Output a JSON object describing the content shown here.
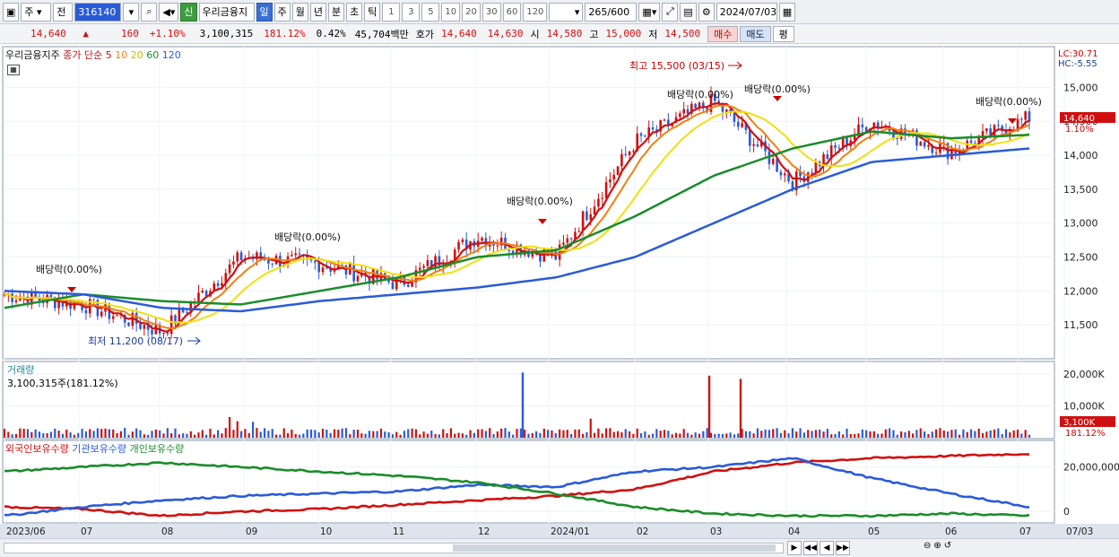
{
  "toolbar": {
    "market": "주",
    "period_type": "전",
    "code": "316140",
    "badge_new": "신",
    "name": "우리금융지",
    "period_tabs": [
      "일",
      "주",
      "월",
      "년",
      "분",
      "초",
      "틱"
    ],
    "active_period": "일",
    "intervals": [
      "1",
      "3",
      "5",
      "10",
      "20",
      "30",
      "60",
      "120"
    ],
    "count": "265",
    "count_max": "/600",
    "date": "2024/07/03"
  },
  "quote": {
    "price": "14,640",
    "change_arrow": "▲",
    "change": "160",
    "change_pct": "+1.10%",
    "volume": "3,100,315",
    "volume_ratio": "181.12%",
    "turnover": "0.42%",
    "amount": "45,704백만",
    "bid_label": "호가",
    "ask1": "14,640",
    "bid1": "14,630",
    "open_label": "시",
    "open": "14,580",
    "high_label": "고",
    "high": "15,000",
    "low_label": "저",
    "low": "14,500",
    "buy_label": "매수",
    "sell_label": "매도",
    "eval_label": "평"
  },
  "price_panel": {
    "title": "우리금융지주",
    "ma_label": "종가 단순",
    "ma_periods": [
      "5",
      "10",
      "20",
      "60",
      "120"
    ],
    "ma_colors": [
      "#d01010",
      "#f08010",
      "#f0e010",
      "#1a8c2a",
      "#2a5bd7"
    ],
    "lc": "LC:30.71",
    "hc": "HC:-5.55",
    "current_price_tag": "14,640",
    "current_pct_tag": "1.10%",
    "annotations": {
      "high": "최고 15,500 (03/15)",
      "low": "최저 11,200 (08/17)",
      "dividends": [
        "배당락(0.00%)",
        "배당락(0.00%)",
        "배당락(0.00%)",
        "배당락(0.00%)",
        "배당락(0.00%)",
        "배당락(0.00%)"
      ]
    }
  },
  "volume_panel": {
    "title": "거래량",
    "value": "3,100,315주(181.12%)",
    "tag": "3,100K",
    "tag_pct": "181.12%"
  },
  "holding_panel": {
    "series": [
      "외국인보유수량",
      "기관보유수량",
      "개인보유수량"
    ],
    "colors": [
      "#d01010",
      "#2a5bd7",
      "#1a8c2a"
    ]
  },
  "chart_data": [
    {
      "type": "line",
      "title": "우리금융지주",
      "x": [
        "2023/06",
        "07",
        "08",
        "09",
        "10",
        "11",
        "12",
        "2024/01",
        "02",
        "03",
        "04",
        "05",
        "06",
        "07"
      ],
      "series": [
        {
          "name": "5",
          "values": [
            11950,
            11800,
            11400,
            12500,
            12400,
            12100,
            12800,
            12500,
            14200,
            14800,
            13600,
            14500,
            14050,
            14550
          ]
        },
        {
          "name": "60",
          "values": [
            11750,
            11950,
            11850,
            11800,
            12000,
            12200,
            12500,
            12600,
            13100,
            13700,
            14100,
            14350,
            14250,
            14300
          ]
        },
        {
          "name": "120",
          "values": [
            12000,
            11950,
            11750,
            11700,
            11850,
            11950,
            12050,
            12200,
            12500,
            13000,
            13500,
            13900,
            14000,
            14100
          ]
        }
      ],
      "ylim": [
        11000,
        15600
      ],
      "yticks": [
        "11,500",
        "12,000",
        "12,500",
        "13,000",
        "13,500",
        "14,000",
        "14,500",
        "15,000"
      ]
    },
    {
      "type": "bar",
      "title": "거래량",
      "yticks": [
        "10,000K",
        "20,000K"
      ]
    },
    {
      "type": "line",
      "yticks": [
        "0",
        "20,000,000"
      ],
      "series": [
        {
          "name": "외국인보유수량",
          "values": [
            2,
            1,
            -2,
            0,
            1,
            3,
            5,
            7,
            10,
            18,
            22,
            24,
            25,
            26
          ]
        },
        {
          "name": "기관보유수량",
          "values": [
            -2,
            2,
            5,
            7,
            8,
            9,
            12,
            11,
            18,
            20,
            24,
            15,
            8,
            2
          ]
        },
        {
          "name": "개인보유수량",
          "values": [
            18,
            20,
            22,
            20,
            18,
            16,
            13,
            8,
            2,
            -1,
            -2,
            -2,
            -1,
            -2
          ]
        }
      ]
    }
  ]
}
